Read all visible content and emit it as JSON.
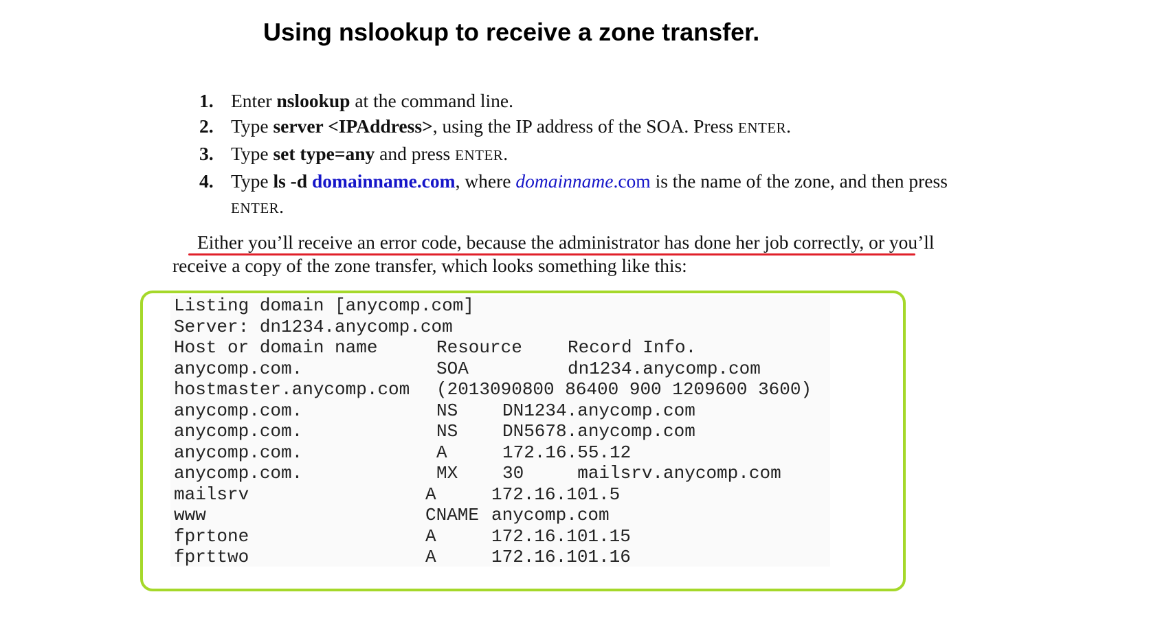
{
  "title": "Using nslookup to receive a zone transfer.",
  "steps": [
    {
      "number": "1.",
      "parts": [
        {
          "text": "Enter ",
          "style": "plain"
        },
        {
          "text": "nslookup",
          "style": "bold"
        },
        {
          "text": " at the command line.",
          "style": "plain"
        }
      ]
    },
    {
      "number": "2.",
      "parts": [
        {
          "text": "Type ",
          "style": "plain"
        },
        {
          "text": "server <IPAddress>",
          "style": "bold"
        },
        {
          "text": ", using the IP address of the SOA. Press ",
          "style": "plain"
        },
        {
          "text": "ENTER",
          "style": "smallcaps"
        },
        {
          "text": ".",
          "style": "plain"
        }
      ]
    },
    {
      "number": "3.",
      "parts": [
        {
          "text": "Type ",
          "style": "plain"
        },
        {
          "text": "set type=any",
          "style": "bold"
        },
        {
          "text": " and press ",
          "style": "plain"
        },
        {
          "text": "ENTER",
          "style": "smallcaps"
        },
        {
          "text": ".",
          "style": "plain"
        }
      ]
    },
    {
      "number": "4.",
      "parts": [
        {
          "text": "Type ",
          "style": "plain"
        },
        {
          "text": "ls -d ",
          "style": "bold"
        },
        {
          "text": "domainname.com",
          "style": "blue-bold"
        },
        {
          "text": ", where ",
          "style": "plain"
        },
        {
          "text": "domainname",
          "style": "blue-italic"
        },
        {
          "text": ".com",
          "style": "blue-plain"
        },
        {
          "text": " is the name of the zone, and then press ",
          "style": "plain"
        },
        {
          "text": "ENTER",
          "style": "smallcaps"
        },
        {
          "text": ".",
          "style": "plain"
        }
      ]
    }
  ],
  "paragraph": "Either you’ll receive an error code, because the administrator has done her job correctly, or you’ll receive a copy of the zone transfer, which looks something like this:",
  "code_lines": [
    {
      "host": "Listing domain [anycomp.com]",
      "type": "",
      "value": "",
      "col": "full"
    },
    {
      "host": "Server: dn1234.anycomp.com",
      "type": "",
      "value": "",
      "col": "full"
    },
    {
      "host": "Host or domain name",
      "type": "Resource",
      "value": "Record Info.",
      "col": "wide"
    },
    {
      "host": "anycomp.com.",
      "type": "SOA",
      "value": "dn1234.anycomp.com",
      "col": "wide"
    },
    {
      "host": "hostmaster.anycomp.com",
      "type": "(2013090800 86400 900 1209600 3600)",
      "value": "",
      "col": "soa"
    },
    {
      "host": "anycomp.com.",
      "type": "NS",
      "value": "DN1234.anycomp.com",
      "col": "narrow"
    },
    {
      "host": "anycomp.com.",
      "type": "NS",
      "value": "DN5678.anycomp.com",
      "col": "narrow"
    },
    {
      "host": "anycomp.com.",
      "type": "A",
      "value": "172.16.55.12",
      "col": "narrow"
    },
    {
      "host": "anycomp.com.",
      "type": "MX",
      "value": "30     mailsrv.anycomp.com",
      "col": "narrow"
    },
    {
      "host": "mailsrv",
      "type": "A",
      "value": "172.16.101.5",
      "col": "short"
    },
    {
      "host": "www",
      "type": "CNAME",
      "value": "anycomp.com",
      "col": "short"
    },
    {
      "host": "fprtone",
      "type": "A",
      "value": "172.16.101.15",
      "col": "short"
    },
    {
      "host": "fprttwo",
      "type": "A",
      "value": "172.16.101.16",
      "col": "short"
    }
  ],
  "colors": {
    "underline": "#e0202a",
    "box_border": "#a5d82a",
    "link_blue": "#1515c8"
  }
}
